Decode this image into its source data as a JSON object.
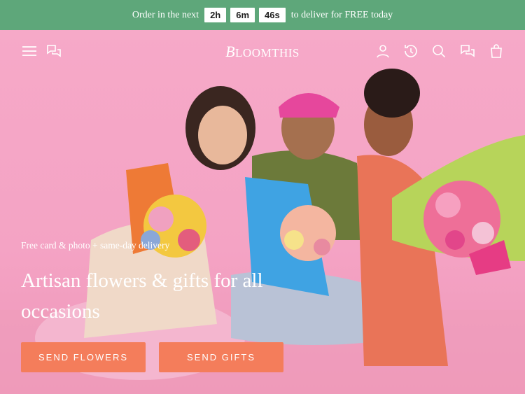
{
  "promo": {
    "prefix": "Order in the next",
    "hours": "2h",
    "minutes": "6m",
    "seconds": "46s",
    "suffix": "to deliver for FREE today"
  },
  "header": {
    "logo_initial": "B",
    "logo_rest": "LOOMTHIS",
    "left_icons": [
      "menu-icon",
      "chat-icon"
    ],
    "right_icons": [
      "account-icon",
      "history-icon",
      "search-icon",
      "chat-icon",
      "bag-icon"
    ]
  },
  "hero": {
    "subtitle": "Free card & photo + same-day delivery",
    "headline": "Artisan flowers & gifts for all occasions",
    "buttons": {
      "send_flowers": "SEND FLOWERS",
      "send_gifts": "SEND GIFTS"
    }
  },
  "colors": {
    "promo_bg": "#5ea77a",
    "hero_bg": "#f6a9c8",
    "button": "#f47d5b"
  }
}
